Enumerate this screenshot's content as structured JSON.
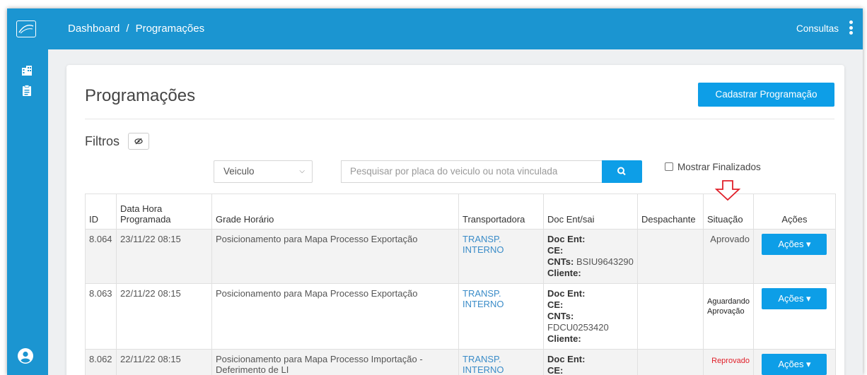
{
  "header": {
    "breadcrumb": [
      "Dashboard",
      "/",
      "Programações"
    ],
    "menu_label": "Consultas"
  },
  "sidebar": {
    "icons": [
      "building-icon",
      "clipboard-icon",
      "user-icon"
    ]
  },
  "page": {
    "title": "Programações",
    "primary_button": "Cadastrar Programação"
  },
  "filters": {
    "title": "Filtros",
    "select_value": "Veiculo",
    "search_placeholder": "Pesquisar por placa do veiculo ou nota vinculada",
    "checkbox_label": "Mostrar Finalizados"
  },
  "table": {
    "columns": [
      "ID",
      "Data Hora Programada",
      "Grade Horário",
      "Transportadora",
      "Doc Ent/sai",
      "Despachante",
      "Situação",
      "Ações"
    ],
    "rows": [
      {
        "id": "8.064",
        "datetime": "23/11/22 08:15",
        "grade": "Posicionamento para Mapa Processo Exportação",
        "transportadora": "TRANSP. INTERNO",
        "doc_ent": "Doc Ent:",
        "ce": "CE:",
        "cnts_label": "CNTs:",
        "cnts_value": "BSIU9643290",
        "cliente": "Cliente:",
        "despachante": "",
        "situacao": "Aprovado",
        "acoes": "Ações ▾"
      },
      {
        "id": "8.063",
        "datetime": "22/11/22 08:15",
        "grade": "Posicionamento para Mapa Processo Exportação",
        "transportadora": "TRANSP. INTERNO",
        "doc_ent": "Doc Ent:",
        "ce": "CE:",
        "cnts_label": "CNTs:",
        "cnts_value": "FDCU0253420",
        "cliente": "Cliente:",
        "despachante": "",
        "situacao": "Aguardando Aprovação",
        "acoes": "Ações ▾"
      },
      {
        "id": "8.062",
        "datetime": "22/11/22 08:15",
        "grade": "Posicionamento para Mapa Processo Importação - Deferimento de LI",
        "transportadora": "TRANSP. INTERNO",
        "doc_ent": "Doc Ent:",
        "ce": "CE:",
        "despachante": "",
        "situacao": "Reprovado",
        "acoes": "Ações ▾"
      }
    ]
  },
  "colors": {
    "brand": "#1b95d1",
    "button": "#0d9ee7",
    "link": "#3a8cc8",
    "rejected": "#e0202a",
    "annotation_arrow": "#e0202a"
  }
}
